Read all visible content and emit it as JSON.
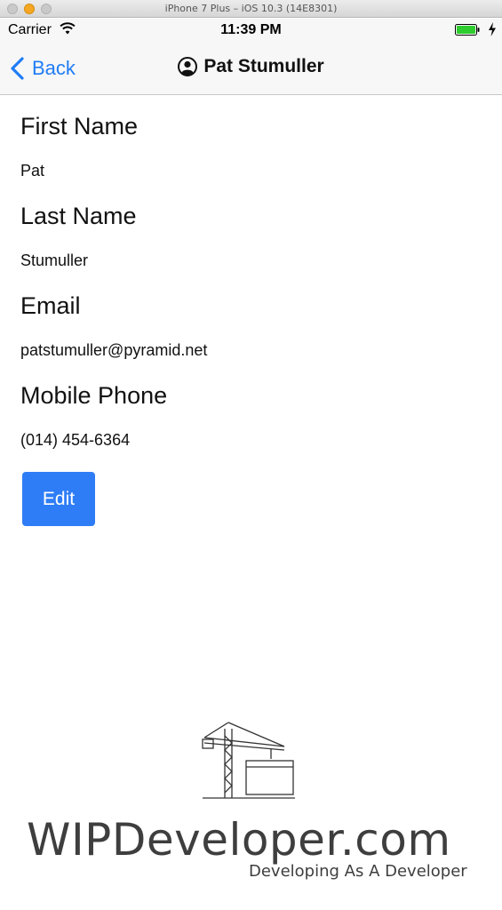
{
  "window": {
    "title": "iPhone 7 Plus – iOS 10.3 (14E8301)"
  },
  "status_bar": {
    "carrier": "Carrier",
    "time": "11:39 PM",
    "battery_color": "#2ecc2e"
  },
  "nav": {
    "back_label": "Back",
    "title": "Pat Stumuller",
    "accent_color": "#1f7cf6"
  },
  "fields": [
    {
      "label": "First Name",
      "value": "Pat"
    },
    {
      "label": "Last Name",
      "value": "Stumuller"
    },
    {
      "label": "Email",
      "value": "patstumuller@pyramid.net"
    },
    {
      "label": "Mobile Phone",
      "value": "(014) 454-6364"
    }
  ],
  "actions": {
    "edit_label": "Edit",
    "edit_color": "#2f7df6"
  },
  "watermark": {
    "brand": "WIPDeveloper.com",
    "tagline": "Developing As A Developer",
    "logo_icon": "construction-crane-icon"
  }
}
